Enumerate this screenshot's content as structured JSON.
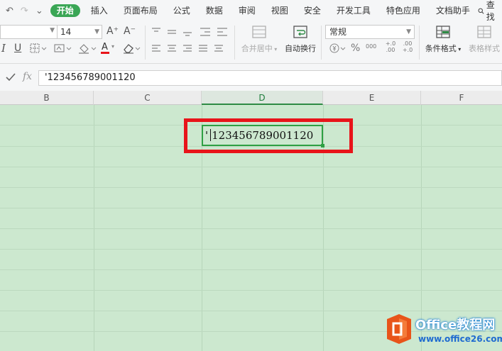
{
  "quick_access": {
    "undo": "↶",
    "redo": "↷",
    "more": "⌄"
  },
  "tabs": [
    {
      "label": "开始",
      "active": true
    },
    {
      "label": "插入"
    },
    {
      "label": "页面布局"
    },
    {
      "label": "公式"
    },
    {
      "label": "数据"
    },
    {
      "label": "审阅"
    },
    {
      "label": "视图"
    },
    {
      "label": "安全"
    },
    {
      "label": "开发工具"
    },
    {
      "label": "特色应用"
    },
    {
      "label": "文档助手"
    }
  ],
  "search_label": "查找",
  "toolbar": {
    "font_size": "14",
    "grow_font": "A⁺",
    "shrink_font": "A⁻",
    "italic": "I",
    "underline": "U",
    "merge_center_label": "合并居中",
    "wrap_text_label": "自动换行",
    "number_format": "常规",
    "percent": "%",
    "thousands": "000",
    "inc_decimal": "+.0 .00",
    "dec_decimal": ".00 +.0",
    "conditional_format_label": "条件格式",
    "table_style_label": "表格样式",
    "font_color": "#e8141a"
  },
  "formula_bar": {
    "fx": "fx",
    "content": "'123456789001120"
  },
  "columns": [
    "B",
    "C",
    "D",
    "E",
    "F"
  ],
  "selected_column": "D",
  "active_cell": {
    "apostrophe": "'",
    "value": "123456789001120"
  },
  "watermark": {
    "brand": "Office教程网",
    "site": "www.office26.com"
  },
  "colors": {
    "accent": "#3aa655",
    "sheet_bg": "#cce8cf",
    "highlight": "#e8141a"
  }
}
